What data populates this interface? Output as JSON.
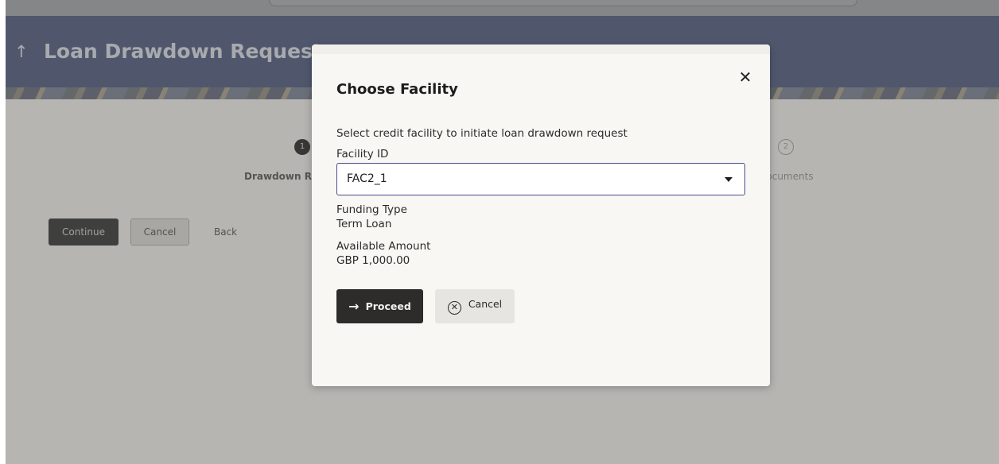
{
  "header": {
    "title": "Loan Drawdown Request",
    "back_icon": "up-arrow-icon"
  },
  "stepper": {
    "steps": [
      {
        "number": "1",
        "label": "Drawdown Req",
        "state": "active"
      },
      {
        "number": "2",
        "label": "l Documents",
        "state": "inactive"
      }
    ]
  },
  "page_actions": {
    "continue_label": "Continue",
    "cancel_label": "Cancel",
    "back_label": "Back"
  },
  "modal": {
    "title": "Choose Facility",
    "close_icon": "close-icon",
    "description": "Select credit facility to initiate loan drawdown request",
    "facility_label": "Facility ID",
    "facility_value": "FAC2_1",
    "funding_type_label": "Funding Type",
    "funding_type_value": "Term Loan",
    "available_amount_label": "Available Amount",
    "available_amount_value": "GBP 1,000.00",
    "proceed_label": "Proceed",
    "proceed_icon": "→",
    "cancel_label": "Cancel",
    "cancel_icon": "⊗"
  },
  "colors": {
    "header_bg": "#465377",
    "primary_button": "#2d2c2a",
    "modal_bg": "#f8f7f4",
    "select_border": "#4a4c8c"
  }
}
